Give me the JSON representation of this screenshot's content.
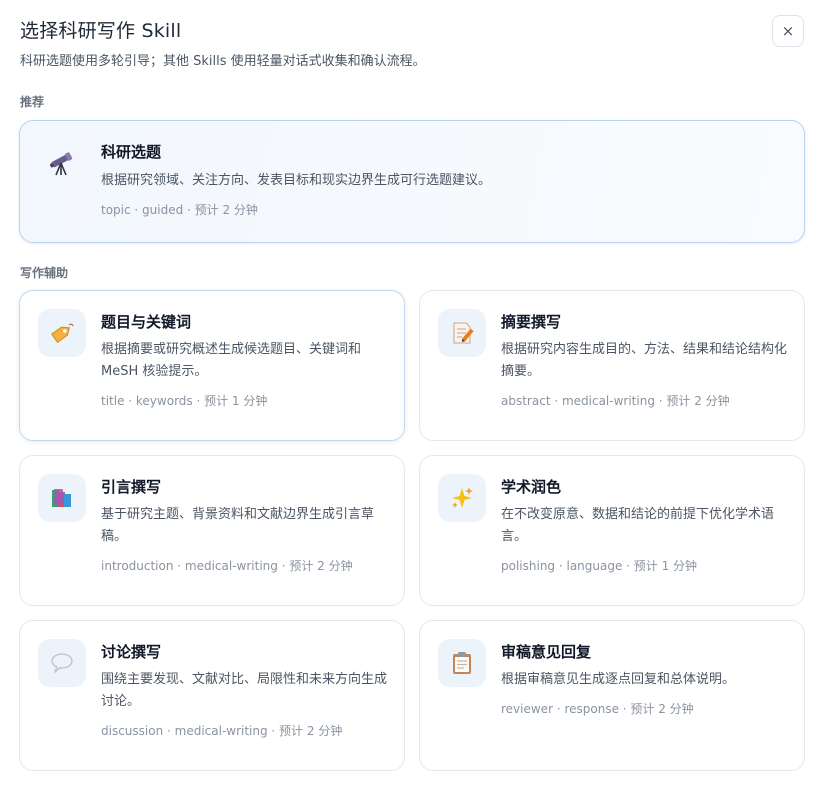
{
  "dialog": {
    "title": "选择科研写作 Skill",
    "subtitle": "科研选题使用多轮引导；其他 Skills 使用轻量对话式收集和确认流程。",
    "close_label": "×"
  },
  "sections": {
    "recommended": "推荐",
    "writing": "写作辅助"
  },
  "featured": {
    "icon": "telescope-icon",
    "title": "科研选题",
    "desc": "根据研究领域、关注方向、发表目标和现实边界生成可行选题建议。",
    "meta": "topic · guided · 预计 2 分钟"
  },
  "skills": [
    {
      "icon": "tag-icon",
      "title": "题目与关键词",
      "desc": "根据摘要或研究概述生成候选题目、关键词和MeSH 核验提示。",
      "meta": "title · keywords · 预计 1 分钟"
    },
    {
      "icon": "memo-icon",
      "title": "摘要撰写",
      "desc": "根据研究内容生成目的、方法、结果和结论结构化摘要。",
      "meta": "abstract · medical-writing · 预计 2 分钟"
    },
    {
      "icon": "books-icon",
      "title": "引言撰写",
      "desc": "基于研究主题、背景资料和文献边界生成引言草稿。",
      "meta": "introduction · medical-writing · 预计 2 分钟"
    },
    {
      "icon": "sparkles-icon",
      "title": "学术润色",
      "desc": "在不改变原意、数据和结论的前提下优化学术语言。",
      "meta": "polishing · language · 预计 1 分钟"
    },
    {
      "icon": "speech-bubble-icon",
      "title": "讨论撰写",
      "desc": "围绕主要发现、文献对比、局限性和未来方向生成讨论。",
      "meta": "discussion · medical-writing · 预计 2 分钟"
    },
    {
      "icon": "clipboard-icon",
      "title": "审稿意见回复",
      "desc": "根据审稿意见生成逐点回复和总体说明。",
      "meta": "reviewer · response · 预计 2 分钟"
    }
  ]
}
